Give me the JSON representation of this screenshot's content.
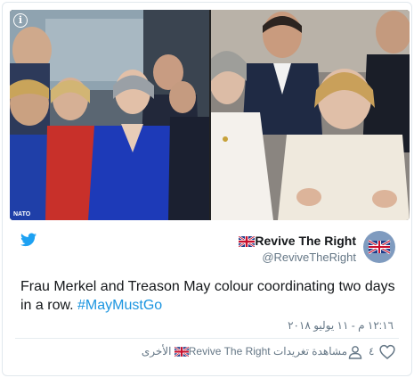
{
  "media": {
    "left_caption": "NATO",
    "info_glyph": "i"
  },
  "author": {
    "display_name": "Revive The Right",
    "handle": "@ReviveTheRight",
    "flag_icon": "uk-flag-icon",
    "avatar_icon": "uk-flag-avatar"
  },
  "tweet": {
    "text_prefix": "Frau Merkel and Treason May colour coordinating two days in a row. ",
    "hashtag": "#MayMustGo",
    "timestamp": "١٢:١٦ م - ١١ يوليو ٢٠١٨"
  },
  "actions": {
    "like_count": "٤",
    "views_prefix": "مشاهدة تغريدات",
    "views_name": "Revive The Right",
    "views_suffix": "الأخرى"
  },
  "colors": {
    "twitter_blue": "#1da1f2",
    "hashtag_blue": "#1b95e0",
    "muted_text": "#657786"
  }
}
